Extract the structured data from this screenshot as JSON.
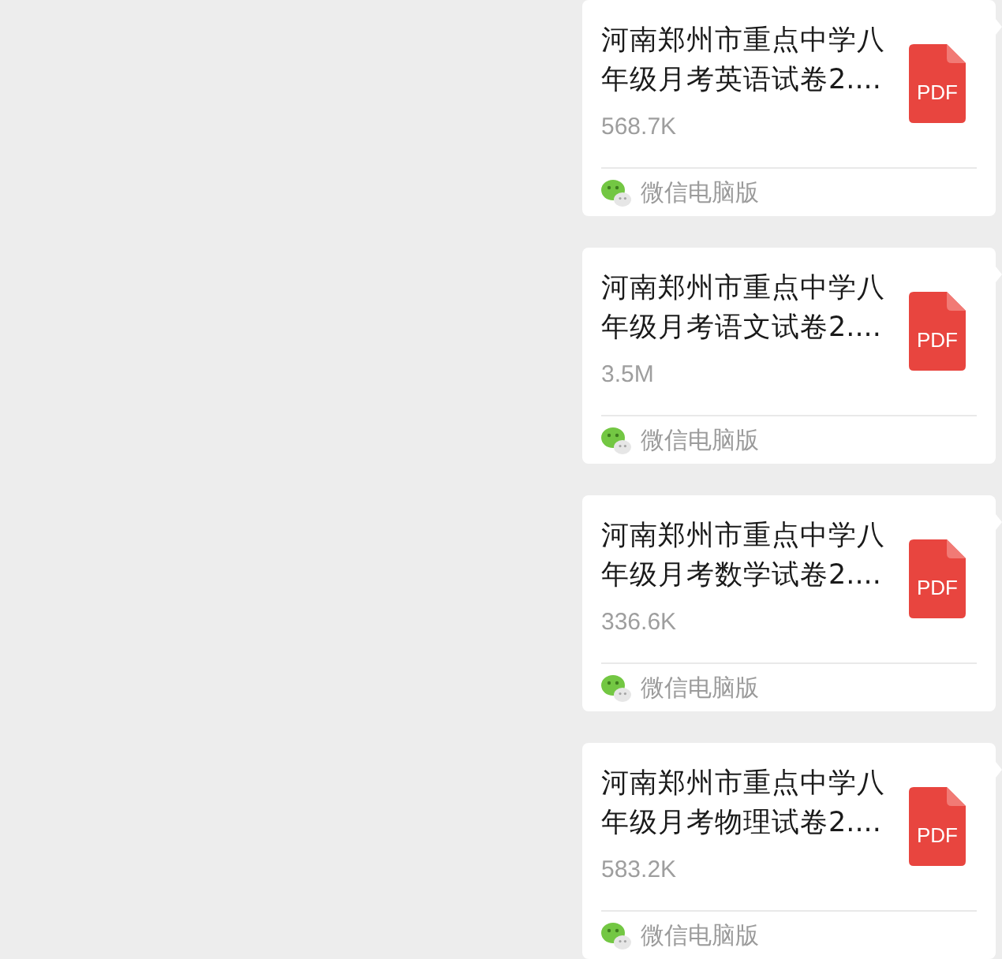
{
  "messages": [
    {
      "file": {
        "name": "河南郑州市重点中学八年级月考英语试卷2....",
        "size": "568.7K",
        "type_label": "PDF"
      },
      "source": "微信电脑版"
    },
    {
      "file": {
        "name": "河南郑州市重点中学八年级月考语文试卷2....",
        "size": "3.5M",
        "type_label": "PDF"
      },
      "source": "微信电脑版"
    },
    {
      "file": {
        "name": "河南郑州市重点中学八年级月考数学试卷2....",
        "size": "336.6K",
        "type_label": "PDF"
      },
      "source": "微信电脑版"
    },
    {
      "file": {
        "name": "河南郑州市重点中学八年级月考物理试卷2....",
        "size": "583.2K",
        "type_label": "PDF"
      },
      "source": "微信电脑版"
    }
  ]
}
